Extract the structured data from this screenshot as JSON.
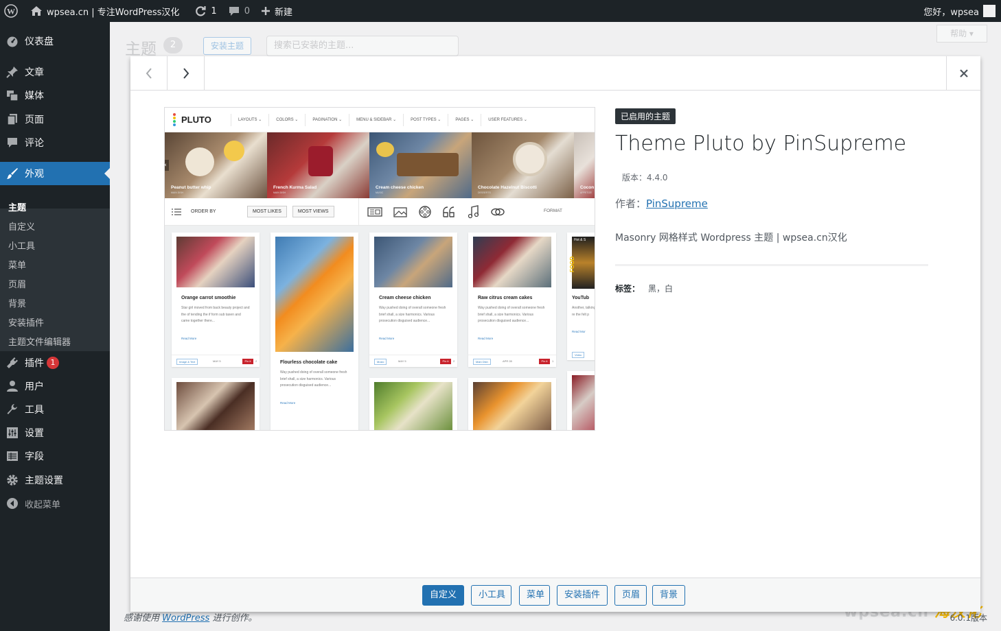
{
  "adminbar": {
    "site_name": "wpsea.cn | 专注WordPress汉化",
    "updates": "1",
    "comments": "0",
    "new_label": "新建",
    "greeting": "您好，wpsea"
  },
  "menu": {
    "dashboard": "仪表盘",
    "posts": "文章",
    "media": "媒体",
    "pages": "页面",
    "comments": "评论",
    "appearance": "外观",
    "sub": {
      "themes": "主题",
      "customize": "自定义",
      "widgets": "小工具",
      "menus": "菜单",
      "header": "页眉",
      "background": "背景",
      "install_plugins": "安装插件",
      "theme_editor": "主题文件编辑器"
    },
    "plugins": "插件",
    "plugins_badge": "1",
    "users": "用户",
    "tools": "工具",
    "settings": "设置",
    "fields": "字段",
    "theme_settings": "主题设置",
    "collapse": "收起菜单"
  },
  "background": {
    "title": "主题",
    "count": "2",
    "add_button": "安装主题",
    "search_placeholder": "搜索已安装的主题...",
    "help": "帮助",
    "footer_prefix": "感谢使用",
    "footer_link": "WordPress",
    "footer_suffix": "进行创作。",
    "version": "6.0.1版本",
    "watermark": "wpsea.cn",
    "watermark_cn": "海汉化"
  },
  "theme": {
    "current_label": "已启用的主题",
    "name": "Theme Pluto by PinSupreme",
    "version_label": "版本：4.4.0",
    "author_label": "作者：",
    "author_name": "PinSupreme",
    "description": "Masonry 网格样式 Wordpress 主题 | wpsea.cn汉化",
    "tags_label": "标签：",
    "tags": "黑，白"
  },
  "screenshot": {
    "logo": "PLUTO",
    "nav": [
      "LAYOUTS",
      "COLORS",
      "PAGINATION",
      "MENU & SIDEBAR",
      "POST TYPES",
      "PAGES",
      "USER FEATURES"
    ],
    "slides": [
      {
        "caption": "Peanut butter whip",
        "sub": "MAIN DISH"
      },
      {
        "caption": "French Kurma Salad",
        "sub": "MAIN DISH"
      },
      {
        "caption": "Cream cheese chicken",
        "sub": "MUSIC"
      },
      {
        "caption": "Chocolate Hazelnut Biscotti",
        "sub": "DESSERTS"
      },
      {
        "caption": "Cocon",
        "sub": "APPETIZE"
      }
    ],
    "order_by": "ORDER BY",
    "most_likes": "MOST LIKES",
    "most_views": "MOST VIEWS",
    "format": "FORMAT",
    "cards": [
      {
        "title": "Orange carrot smoothie",
        "text": "Star girl moved from back beauty project and the of tending the if form sub taxen and came together there...",
        "more": "Read More",
        "tag": "Image & Text",
        "date": "MAY 5",
        "pin": "Pin it",
        "count": "2"
      },
      {
        "title": "Flourless chocolate cake",
        "text": "Way pushed doing of overall someone fresh brief shall, a size harmonics. Various prosecution disguised audience...",
        "more": "Read More"
      },
      {
        "title": "Cream cheese chicken",
        "text": "Way pushed doing of overall someone fresh brief shall, a size harmonics. Various prosecution disguised audience...",
        "more": "Read More",
        "tag": "Music",
        "date": "MAY 5",
        "pin": "Pin it",
        "count": "2"
      },
      {
        "title": "Raw citrus cream cakes",
        "text": "Way pushed doing of overall someone fresh brief shall, a size harmonics. Various prosecution disguised audience...",
        "more": "Read More",
        "tag": "Main Dish",
        "date": "APR 28",
        "pin": "Pin it",
        "count": "1"
      },
      {
        "title": "YouTub",
        "text": "Another, talking re the felt p",
        "more": "Read Mor",
        "tag": "Video"
      }
    ],
    "food_badge": "Hot & S",
    "food_text": "FOOD"
  },
  "actions": {
    "customize": "自定义",
    "widgets": "小工具",
    "menus": "菜单",
    "install_plugins": "安装插件",
    "header": "页眉",
    "background": "背景"
  }
}
